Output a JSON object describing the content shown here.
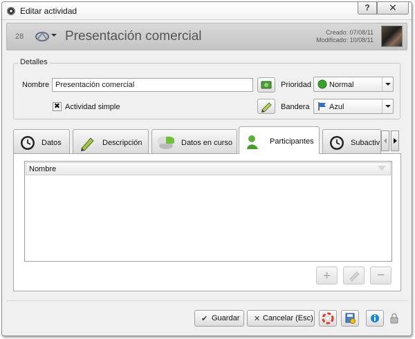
{
  "window": {
    "title": "Editar actividad",
    "help_glyph": "?",
    "close_glyph": "✕"
  },
  "header": {
    "record_id": "28",
    "title": "Presentación comercial",
    "created": "Creado: 07/08/11",
    "modified": "Modificado: 10/08/11"
  },
  "details": {
    "legend": "Detalles",
    "name_label": "Nombre",
    "name_value": "Presentación comercial",
    "simple_checked_glyph": "✖",
    "simple_label": "Actividad simple",
    "priority_label": "Prioridad",
    "priority_value": "Normal",
    "priority_color": "#3aa12c",
    "flag_label": "Bandera",
    "flag_value": "Azul"
  },
  "tabs": [
    {
      "label": "Datos",
      "icon": "clock-icon"
    },
    {
      "label": "Descripción",
      "icon": "pencil-icon"
    },
    {
      "label": "Datos en curso",
      "icon": "pie-chart-icon"
    },
    {
      "label": "Participantes",
      "icon": "person-icon",
      "active": true
    },
    {
      "label": "Subactiv",
      "icon": "clock-icon"
    }
  ],
  "participants": {
    "column_header": "Nombre",
    "add_glyph": "+",
    "remove_glyph": "−"
  },
  "footer": {
    "save_label": "Guardar",
    "save_glyph": "✔",
    "cancel_label": "Cancelar (Esc)",
    "cancel_glyph": "✕"
  },
  "colors": {
    "accent_green": "#3aa12c",
    "flag_blue": "#2a6fd0",
    "help_blue": "#1a86d6",
    "lifebuoy_red": "#d93a2b"
  }
}
